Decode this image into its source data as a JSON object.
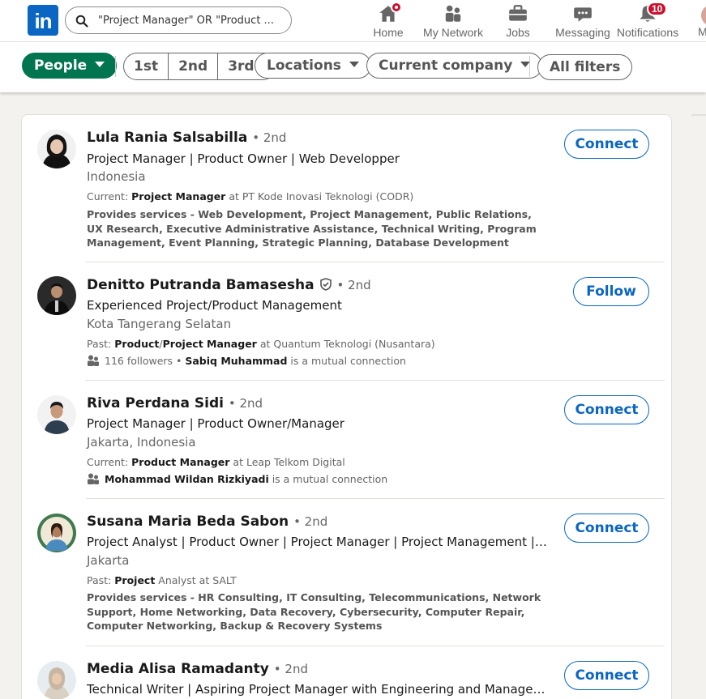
{
  "nav": {
    "logo_text": "in",
    "search_value": "\"Project Manager\" OR \"Product ...",
    "items": [
      {
        "label": "Home"
      },
      {
        "label": "My Network"
      },
      {
        "label": "Jobs"
      },
      {
        "label": "Messaging"
      },
      {
        "label": "Notifications",
        "badge": "10"
      },
      {
        "label": "M"
      }
    ]
  },
  "filters": {
    "people": "People",
    "degrees": [
      "1st",
      "2nd",
      "3rd+"
    ],
    "locations": "Locations",
    "current_company": "Current company",
    "all_filters": "All filters"
  },
  "results": [
    {
      "name": "Lula Rania Salsabilla",
      "degree": "• 2nd",
      "headline": "Project Manager | Product Owner | Web Developper",
      "location": "Indonesia",
      "meta_prefix": "Current: ",
      "meta_bold": "Project Manager",
      "meta_rest": " at PT Kode Inovasi Teknologi (CODR)",
      "services": "Provides services - Web Development, Project Management, Public Relations, UX Research, Executive Administrative Assistance, Technical Writing, Program Management, Event Planning, Strategic Planning, Database Development",
      "action": "Connect"
    },
    {
      "name": "Denitto Putranda Bamasesha",
      "degree": "• 2nd",
      "headline": "Experienced Project/Product Management",
      "location": "Kota Tangerang Selatan",
      "meta_prefix": "Past: ",
      "meta_bold": "Product",
      "meta_sep": "/",
      "meta_bold2": "Project Manager",
      "meta_rest": " at Quantum Teknologi (Nusantara)",
      "followers": "116 followers • ",
      "mutual_name": "Sabiq Muhammad",
      "mutual_rest": " is a mutual connection",
      "action": "Follow"
    },
    {
      "name": "Riva Perdana Sidi",
      "degree": "• 2nd",
      "headline": "Project Manager | Product Owner/Manager",
      "location": "Jakarta, Indonesia",
      "meta_prefix": "Current: ",
      "meta_bold": "Product Manager",
      "meta_rest": " at Leap Telkom Digital",
      "mutual_name": "Mohammad Wildan Rizkiyadi",
      "mutual_rest": " is a mutual connection",
      "action": "Connect"
    },
    {
      "name": "Susana Maria Beda Sabon",
      "degree": "• 2nd",
      "headline": "Project Analyst | Product Owner | Project Manager | Project Management | Product Management",
      "location": "Jakarta",
      "meta_prefix": "Past: ",
      "meta_bold": "Project",
      "meta_rest": " Analyst at SALT",
      "services": "Provides services - HR Consulting, IT Consulting, Telecommunications, Network Support, Home Networking, Data Recovery, Cybersecurity, Computer Repair, Computer Networking, Backup & Recovery Systems",
      "action": "Connect"
    },
    {
      "name": "Media Alisa Ramadanty",
      "degree": "• 2nd",
      "headline": "Technical Writer | Aspiring Project Manager with Engineering and Management Background",
      "action": "Connect"
    }
  ],
  "colors": {
    "brand": "#0a66c2",
    "active_filter": "#01754f",
    "badge": "#cb112d"
  }
}
